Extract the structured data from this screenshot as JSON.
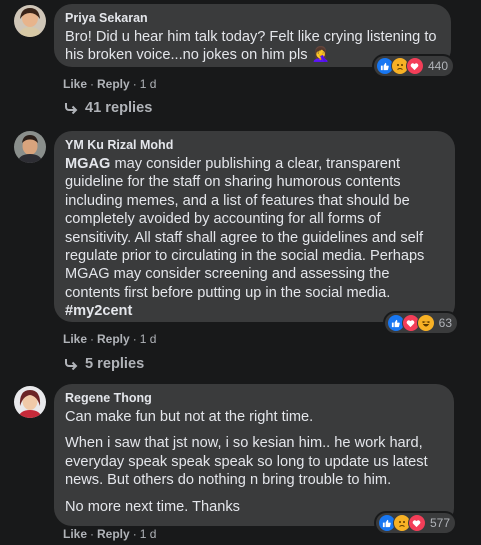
{
  "comments": [
    {
      "author": "Priya Sekaran",
      "text": "Bro! Did u hear him talk today? Felt like crying listening to his broken voice...no jokes on him pls",
      "emoji": "🤦‍♀️",
      "reaction_count": "440",
      "reactions": [
        "like-icon",
        "sad-icon",
        "love-icon"
      ],
      "like_label": "Like",
      "reply_label": "Reply",
      "time": "1 d",
      "replies_label": "41 replies"
    },
    {
      "author": "YM Ku Rizal Mohd",
      "text_lead": "MGAG",
      "text_body": " may consider publishing a clear, transparent guideline for the staff on sharing humorous contents including memes, and a list of features that should be completely avoided by accounting for all forms of sensitivity. All staff shall agree to the guidelines and self regulate prior to circulating in the social media. Perhaps MGAG may consider screening and assessing the contents first before putting up in the social media.",
      "hashtag": "#my2cent",
      "reaction_count": "63",
      "reactions": [
        "like-icon",
        "love-icon",
        "haha-icon"
      ],
      "like_label": "Like",
      "reply_label": "Reply",
      "time": "1 d",
      "replies_label": "5 replies"
    },
    {
      "author": "Regene Thong",
      "paragraphs": [
        "Can make fun but not at the right time.",
        "When i saw that jst now, i so kesian him.. he work hard, everyday speak speak speak so long to update us latest news. But others do nothing n bring trouble to him.",
        "No more next time. Thanks"
      ],
      "reaction_count": "577",
      "reactions": [
        "like-icon",
        "sad-icon",
        "love-icon"
      ],
      "like_label": "Like",
      "reply_label": "Reply",
      "time": "1 d"
    }
  ],
  "colors": {
    "background": "#18191a",
    "bubble": "#3a3b3c",
    "like": "#1877f2",
    "love": "#f33e58",
    "sad": "#f7b125"
  }
}
